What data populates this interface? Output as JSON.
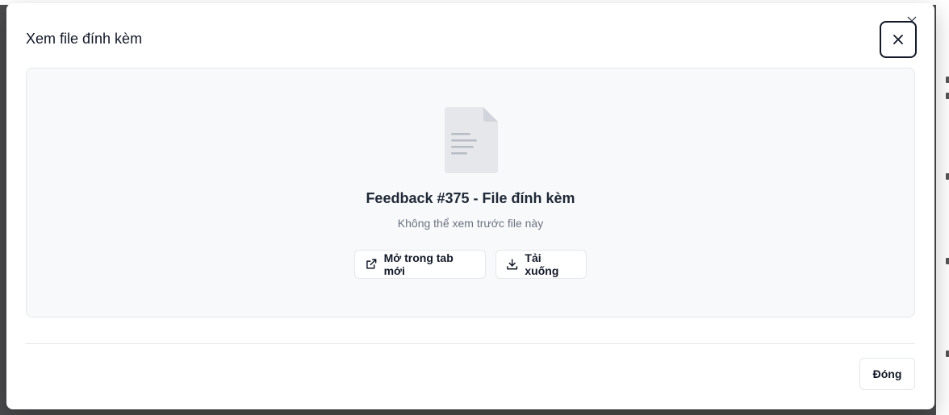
{
  "dialog": {
    "title": "Xem file đính kèm",
    "close_label": "×"
  },
  "preview": {
    "file_name": "Feedback #375 - File đính kèm",
    "message": "Không thể xem trước file này",
    "open_new_tab_label": "Mở trong tab mới",
    "download_label": "Tải xuống"
  },
  "footer": {
    "close_label": "Đóng"
  },
  "icons": {
    "file": "file-text-icon",
    "open": "external-link-icon",
    "download": "download-icon",
    "close": "close-icon"
  },
  "colors": {
    "backdrop": "#4b4b4d",
    "modal_bg": "#ffffff",
    "preview_bg": "#f8f9fb",
    "text_primary": "#111827",
    "text_muted": "#6b7280",
    "border": "#e5e7eb"
  }
}
